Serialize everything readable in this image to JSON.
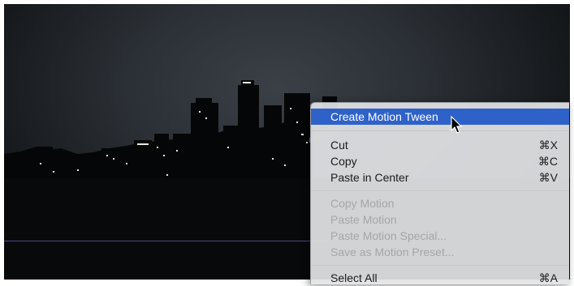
{
  "context_menu": {
    "highlighted": {
      "label": "Create Motion Tween"
    },
    "edit_group": [
      {
        "label": "Cut",
        "shortcut": "⌘X"
      },
      {
        "label": "Copy",
        "shortcut": "⌘C"
      },
      {
        "label": "Paste in Center",
        "shortcut": "⌘V"
      }
    ],
    "motion_group": [
      {
        "label": "Copy Motion"
      },
      {
        "label": "Paste Motion"
      },
      {
        "label": "Paste Motion Special..."
      },
      {
        "label": "Save as Motion Preset..."
      }
    ],
    "select_all": {
      "label": "Select All",
      "shortcut": "⌘A"
    }
  },
  "colors": {
    "highlight": "#2f62c8",
    "disabled_text": "#a5a6a8",
    "stage_line": "#4a4d8a"
  }
}
